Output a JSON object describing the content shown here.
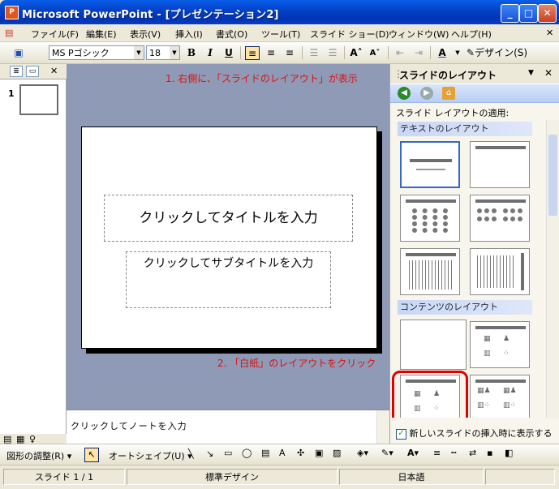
{
  "window": {
    "title": "Microsoft PowerPoint - [プレゼンテーション2]",
    "app_icon": "powerpoint-icon"
  },
  "menu": [
    "ファイル(F)",
    "編集(E)",
    "表示(V)",
    "挿入(I)",
    "書式(O)",
    "ツール(T)",
    "スライド ショー(D)",
    "ウィンドウ(W)",
    "ヘルプ(H)"
  ],
  "toolbar": {
    "font_name": "MS Pゴシック",
    "font_size": "18",
    "bold": "B",
    "italic": "I",
    "underline": "U",
    "design_label": "デザイン(S)"
  },
  "left_panel": {
    "slide_number": "1"
  },
  "slide": {
    "title_placeholder": "クリックしてタイトルを入力",
    "subtitle_placeholder": "クリックしてサブタイトルを入力"
  },
  "annotations": {
    "step1": "1. 右側に、「スライドのレイアウト」が表示",
    "step2": "2. 「白紙」のレイアウトをクリック"
  },
  "notes": {
    "placeholder": "クリックしてノートを入力"
  },
  "task_pane": {
    "title": "スライドのレイアウト",
    "apply_label": "スライド レイアウトの適用:",
    "section_text": "テキストのレイアウト",
    "section_content": "コンテンツのレイアウト",
    "show_on_insert": "新しいスライドの挿入時に表示する",
    "show_on_insert_checked": true
  },
  "drawing_toolbar": {
    "adjust_label": "図形の調整(R)",
    "autoshape_label": "オートシェイプ(U)"
  },
  "status": {
    "slide": "スライド 1 / 1",
    "design": "標準デザイン",
    "language": "日本語"
  },
  "colors": {
    "annotation": "#e01010",
    "slide_bg": "#8e9ab6",
    "highlight_ring": "#e00000"
  }
}
